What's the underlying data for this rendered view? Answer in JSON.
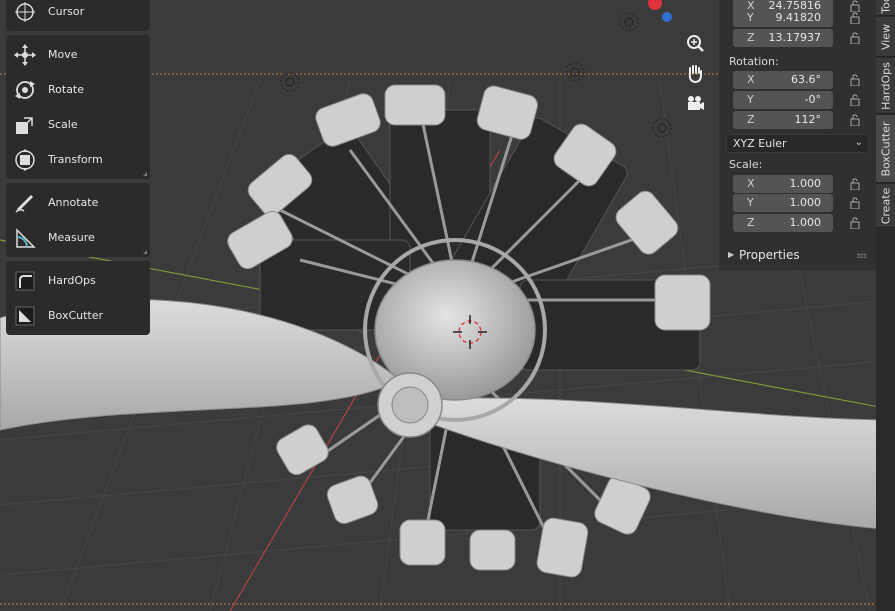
{
  "toolbar": {
    "groups": [
      [
        {
          "label": "Cursor",
          "icon": "cursor-icon"
        }
      ],
      [
        {
          "label": "Move",
          "icon": "move-icon"
        },
        {
          "label": "Rotate",
          "icon": "rotate-icon"
        },
        {
          "label": "Scale",
          "icon": "scale-icon"
        },
        {
          "label": "Transform",
          "icon": "transform-icon"
        }
      ],
      [
        {
          "label": "Annotate",
          "icon": "annotate-icon"
        },
        {
          "label": "Measure",
          "icon": "measure-icon"
        }
      ],
      [
        {
          "label": "HardOps",
          "icon": "hardops-icon"
        },
        {
          "label": "BoxCutter",
          "icon": "boxcutter-icon"
        }
      ]
    ]
  },
  "navigation": [
    "zoom-icon",
    "hand-pan-icon",
    "camera-icon"
  ],
  "gizmo_colors": {
    "x_axis": "#e0323c",
    "z_axis": "#3070d0"
  },
  "transform": {
    "location": {
      "x": "24.75816",
      "y": "9.41820",
      "z": "13.17937"
    },
    "rotation_label": "Rotation:",
    "rotation": {
      "x": "63.6°",
      "y": "-0°",
      "z": "112°"
    },
    "rotation_mode": "XYZ Euler",
    "scale_label": "Scale:",
    "scale": {
      "x": "1.000",
      "y": "1.000",
      "z": "1.000"
    },
    "axis_labels": {
      "x": "X",
      "y": "Y",
      "z": "Z"
    }
  },
  "properties_label": "Properties",
  "side_tabs": [
    "Create",
    "BoxCutter",
    "HardOps",
    "View",
    "Tool"
  ],
  "viewport_colors": {
    "background": "#3b3b3b",
    "model": "#cfcfcf",
    "grid": "#454545",
    "x_line": "#b04444",
    "y_line": "#7a9a3a"
  }
}
